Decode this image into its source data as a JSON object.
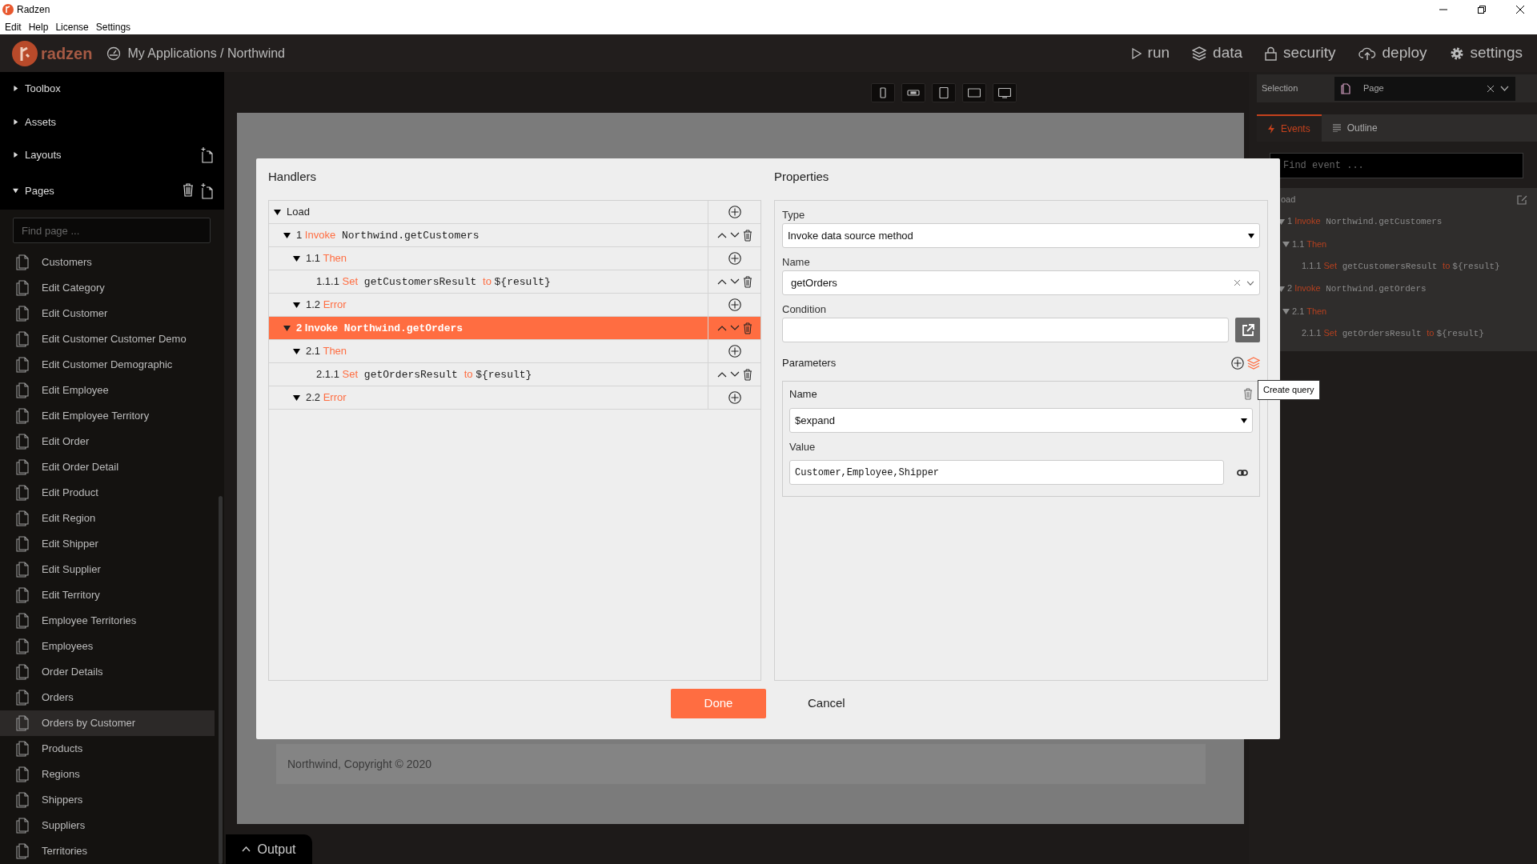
{
  "window": {
    "title": "Radzen"
  },
  "menu": [
    "Edit",
    "Help",
    "License",
    "Settings"
  ],
  "app_header": {
    "logo_text": "radzen",
    "breadcrumb": "My Applications / Northwind",
    "nav": [
      {
        "label": "run"
      },
      {
        "label": "data"
      },
      {
        "label": "security"
      },
      {
        "label": "deploy"
      },
      {
        "label": "settings"
      }
    ]
  },
  "sidebar": {
    "sections": [
      {
        "label": "Toolbox",
        "expanded": false
      },
      {
        "label": "Assets",
        "expanded": false
      },
      {
        "label": "Layouts",
        "expanded": false
      },
      {
        "label": "Pages",
        "expanded": true
      }
    ],
    "search": {
      "placeholder": "Find page ..."
    },
    "pages": [
      {
        "label": "Customers",
        "selected": false
      },
      {
        "label": "Edit Category",
        "selected": false
      },
      {
        "label": "Edit Customer",
        "selected": false
      },
      {
        "label": "Edit Customer Customer Demo",
        "selected": false
      },
      {
        "label": "Edit Customer Demographic",
        "selected": false
      },
      {
        "label": "Edit Employee",
        "selected": false
      },
      {
        "label": "Edit Employee Territory",
        "selected": false
      },
      {
        "label": "Edit Order",
        "selected": false
      },
      {
        "label": "Edit Order Detail",
        "selected": false
      },
      {
        "label": "Edit Product",
        "selected": false
      },
      {
        "label": "Edit Region",
        "selected": false
      },
      {
        "label": "Edit Shipper",
        "selected": false
      },
      {
        "label": "Edit Supplier",
        "selected": false
      },
      {
        "label": "Edit Territory",
        "selected": false
      },
      {
        "label": "Employee Territories",
        "selected": false
      },
      {
        "label": "Employees",
        "selected": false
      },
      {
        "label": "Order Details",
        "selected": false
      },
      {
        "label": "Orders",
        "selected": false
      },
      {
        "label": "Orders by Customer",
        "selected": true
      },
      {
        "label": "Products",
        "selected": false
      },
      {
        "label": "Regions",
        "selected": false
      },
      {
        "label": "Shippers",
        "selected": false
      },
      {
        "label": "Suppliers",
        "selected": false
      },
      {
        "label": "Territories",
        "selected": false
      }
    ]
  },
  "canvas": {
    "footer": "Northwind, Copyright © 2020"
  },
  "output_tab": {
    "label": "Output"
  },
  "right_panel": {
    "selection_label": "Selection",
    "selection_value": "Page",
    "tabs": [
      {
        "label": "Events",
        "selected": true
      },
      {
        "label": "Outline",
        "selected": false
      }
    ],
    "search": {
      "placeholder": "Find event ..."
    },
    "tree": [
      {
        "label": "oad",
        "children": [
          {
            "number": "1",
            "keyword": "Invoke",
            "target": "Northwind.getCustomers",
            "expanded": true,
            "children": [
              {
                "number": "1.1",
                "keyword": "Then",
                "expanded": true,
                "children": [
                  {
                    "number": "1.1.1",
                    "keyword": "Set",
                    "target": "getCustomersResult",
                    "connector": "to",
                    "value": "${result}"
                  }
                ]
              }
            ]
          },
          {
            "number": "2",
            "keyword": "Invoke",
            "target": "Northwind.getOrders",
            "expanded": true,
            "children": [
              {
                "number": "2.1",
                "keyword": "Then",
                "expanded": true,
                "children": [
                  {
                    "number": "2.1.1",
                    "keyword": "Set",
                    "target": "getOrdersResult",
                    "connector": "to",
                    "value": "${result}"
                  }
                ]
              }
            ]
          }
        ]
      }
    ]
  },
  "dialog": {
    "handlers": {
      "title": "Handlers",
      "tree": [
        {
          "label": "Load",
          "kind": "event",
          "expanded": true,
          "selected": false,
          "children": [
            {
              "number": "1",
              "keyword": "Invoke",
              "target": "Northwind.getCustomers",
              "kind": "action",
              "expanded": true,
              "selected": false,
              "children": [
                {
                  "number": "1.1",
                  "keyword": "Then",
                  "kind": "branch",
                  "expanded": true,
                  "selected": false,
                  "children": [
                    {
                      "number": "1.1.1",
                      "keyword": "Set",
                      "target": "getCustomersResult",
                      "connector": "to",
                      "value": "${result}",
                      "kind": "action",
                      "selected": false
                    }
                  ]
                },
                {
                  "number": "1.2",
                  "keyword": "Error",
                  "kind": "branch",
                  "expanded": true,
                  "selected": false
                }
              ]
            },
            {
              "number": "2",
              "keyword": "Invoke",
              "target": "Northwind.getOrders",
              "kind": "action",
              "expanded": true,
              "selected": true,
              "children": [
                {
                  "number": "2.1",
                  "keyword": "Then",
                  "kind": "branch",
                  "expanded": true,
                  "selected": false,
                  "children": [
                    {
                      "number": "2.1.1",
                      "keyword": "Set",
                      "target": "getOrdersResult",
                      "connector": "to",
                      "value": "${result}",
                      "kind": "action",
                      "selected": false
                    }
                  ]
                },
                {
                  "number": "2.2",
                  "keyword": "Error",
                  "kind": "branch",
                  "expanded": true,
                  "selected": false
                }
              ]
            }
          ]
        }
      ]
    },
    "properties": {
      "title": "Properties",
      "type": {
        "label": "Type",
        "value": "Invoke data source method"
      },
      "name": {
        "label": "Name",
        "value": "getOrders"
      },
      "condition": {
        "label": "Condition"
      },
      "parameters": {
        "label": "Parameters",
        "tooltip": "Create query",
        "items": [
          {
            "name_label": "Name",
            "name": "$expand",
            "value_label": "Value",
            "value": "Customer,Employee,Shipper"
          }
        ]
      }
    },
    "buttons": [
      {
        "label": "Done",
        "kind": "primary"
      },
      {
        "label": "Cancel",
        "kind": "link"
      }
    ]
  }
}
